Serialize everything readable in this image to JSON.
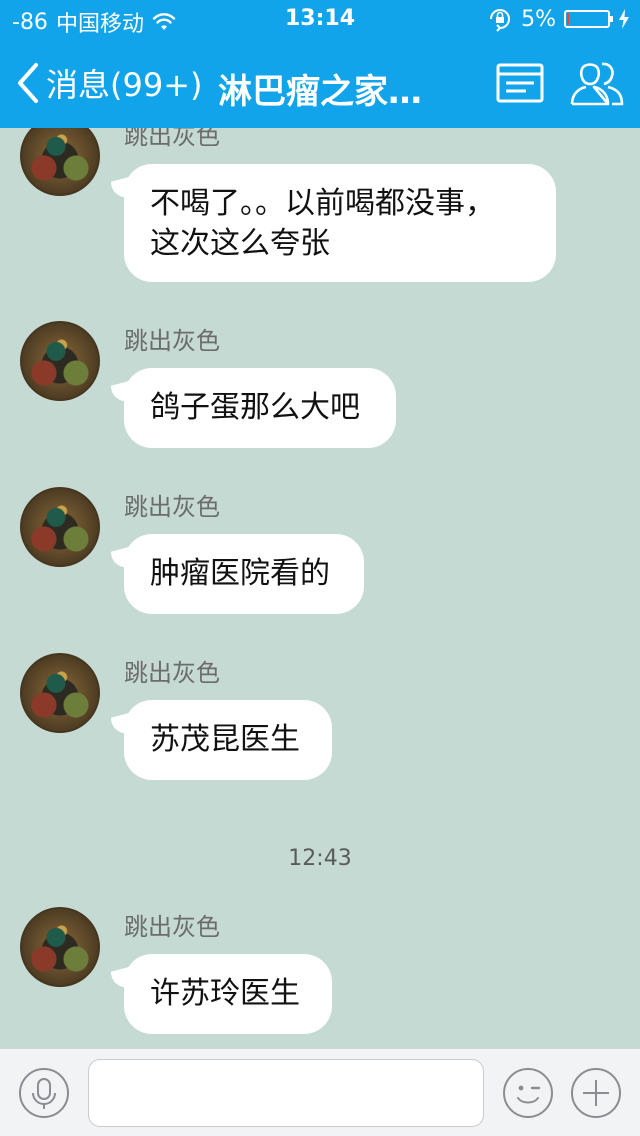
{
  "status_bar": {
    "signal": "-86",
    "carrier": "中国移动",
    "time": "13:14",
    "battery_percent": "5%",
    "battery_level": 0.05,
    "battery_color": "#ff3b30"
  },
  "nav": {
    "back_label": "消息(99+)",
    "title": "淋巴瘤之家…",
    "bar_color": "#12a4ea",
    "icons": [
      "chevron-left-icon",
      "group-info-icon",
      "group-members-icon"
    ]
  },
  "chat": {
    "background": "#c5dad3",
    "timestamp": "12:43",
    "messages": [
      {
        "sender": "跳出灰色",
        "text": "不喝了。。以前喝都没事，\n这次这么夸张"
      },
      {
        "sender": "跳出灰色",
        "text": "鸽子蛋那么大吧"
      },
      {
        "sender": "跳出灰色",
        "text": "肿瘤医院看的"
      },
      {
        "sender": "跳出灰色",
        "text": "苏茂昆医生"
      },
      {
        "sender": "跳出灰色",
        "text": "许苏玲医生"
      }
    ]
  },
  "input_bar": {
    "value": "",
    "icons": [
      "microphone-icon",
      "emoji-icon",
      "plus-icon"
    ]
  }
}
